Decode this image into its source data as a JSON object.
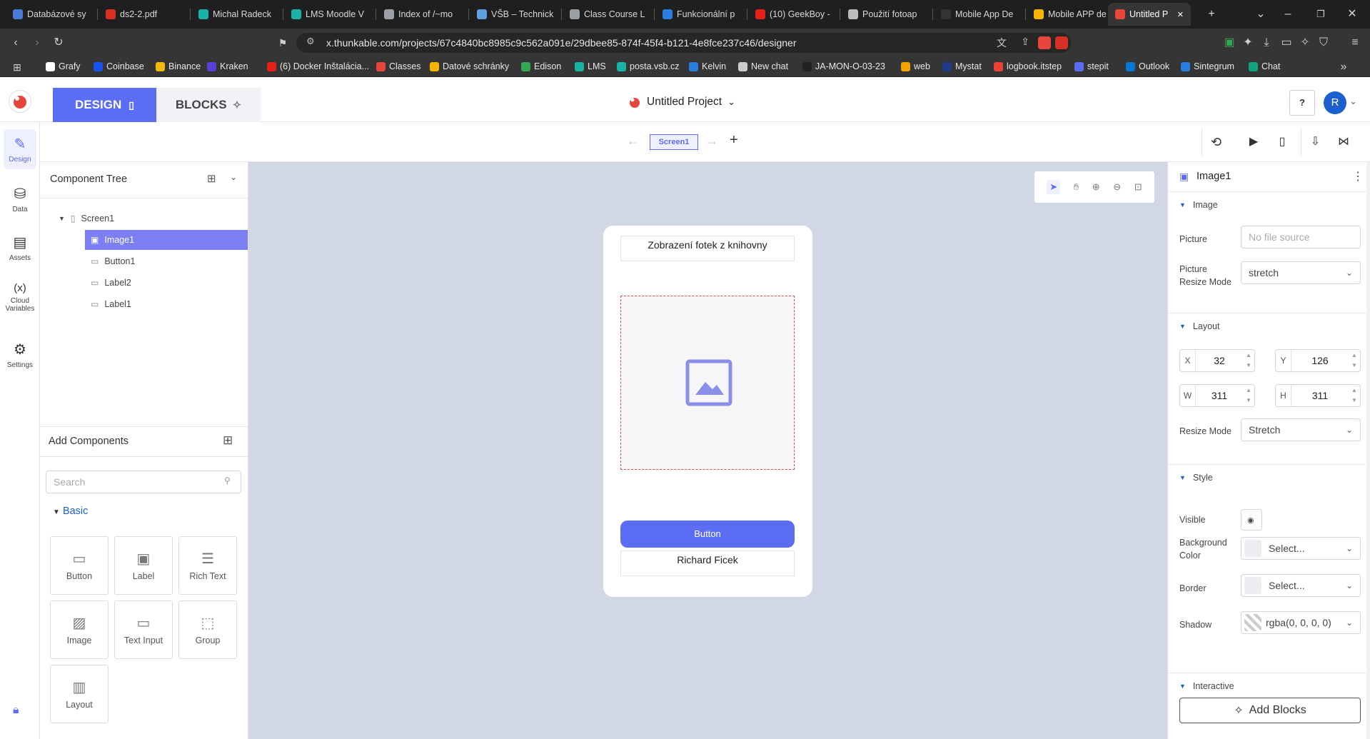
{
  "browser": {
    "tabs": [
      {
        "label": "Databázové sy",
        "color": "#4a7bd8"
      },
      {
        "label": "ds2-2.pdf",
        "color": "#d93025"
      },
      {
        "label": "Michal Radeck",
        "color": "#19b3a6"
      },
      {
        "label": "LMS Moodle V",
        "color": "#19b3a6"
      },
      {
        "label": "Index of /~mo",
        "color": "#9aa0a6"
      },
      {
        "label": "VŠB – Technick",
        "color": "#5fa0e0"
      },
      {
        "label": "Class Course L",
        "color": "#9aa0a6"
      },
      {
        "label": "Funkcionální p",
        "color": "#2a7de1"
      },
      {
        "label": "(10) GeekBoy -",
        "color": "#e62117"
      },
      {
        "label": "Použití fotoap",
        "color": "#bbbbbb"
      },
      {
        "label": "Mobile App De",
        "color": "#333333"
      },
      {
        "label": "Mobile APP de",
        "color": "#f4b400"
      },
      {
        "label": "Untitled P",
        "color": "#e8453c"
      }
    ],
    "url": "x.thunkable.com/projects/67c4840bc8985c9c562a091e/29dbee85-874f-45f4-b121-4e8fce237c46/designer",
    "bookmarks": [
      {
        "label": "Grafy",
        "color": "#ffffff"
      },
      {
        "label": "Coinbase",
        "color": "#1652f0"
      },
      {
        "label": "Binance",
        "color": "#f0b90b"
      },
      {
        "label": "Kraken",
        "color": "#5741d9"
      },
      {
        "label": "(6) Docker Inštalácia...",
        "color": "#e62117"
      },
      {
        "label": "Classes",
        "color": "#e8453c"
      },
      {
        "label": "Datové schránky",
        "color": "#f4b400"
      },
      {
        "label": "Edison",
        "color": "#34a853"
      },
      {
        "label": "LMS",
        "color": "#19b3a6"
      },
      {
        "label": "posta.vsb.cz",
        "color": "#19b3a6"
      },
      {
        "label": "Kelvin",
        "color": "#2a7de1"
      },
      {
        "label": "New chat",
        "color": "#cccccc"
      },
      {
        "label": "JA-MON-O-03-23",
        "color": "#222222"
      },
      {
        "label": "web",
        "color": "#f4a400"
      },
      {
        "label": "Mystat",
        "color": "#1e3a8a"
      },
      {
        "label": "logbook.itstep",
        "color": "#ea4335"
      },
      {
        "label": "stepit",
        "color": "#5b6cf5"
      },
      {
        "label": "Outlook",
        "color": "#0078d4"
      },
      {
        "label": "Sintegrum",
        "color": "#2a7de1"
      },
      {
        "label": "Chat",
        "color": "#10a37f"
      }
    ]
  },
  "header": {
    "design_label": "DESIGN",
    "blocks_label": "BLOCKS",
    "project_title": "Untitled Project",
    "avatar_initial": "R"
  },
  "rail": [
    {
      "label": "Design",
      "icon": "pencil-icon"
    },
    {
      "label": "Data",
      "icon": "database-icon"
    },
    {
      "label": "Assets",
      "icon": "file-icon"
    },
    {
      "label": "Cloud Variables",
      "icon": "variable-icon"
    },
    {
      "label": "Settings",
      "icon": "gear-icon"
    }
  ],
  "screens": {
    "current": "Screen1"
  },
  "tree": {
    "title": "Component Tree",
    "items": [
      {
        "label": "Screen1",
        "level": 0
      },
      {
        "label": "Image1",
        "level": 1,
        "selected": true
      },
      {
        "label": "Button1",
        "level": 1
      },
      {
        "label": "Label2",
        "level": 1
      },
      {
        "label": "Label1",
        "level": 1
      }
    ]
  },
  "add_components": {
    "title": "Add Components",
    "search_placeholder": "Search",
    "category": "Basic",
    "items": [
      "Button",
      "Label",
      "Rich Text",
      "Image",
      "Text Input",
      "Group",
      "Layout"
    ]
  },
  "phone": {
    "label_top": "Zobrazení fotek z knihovny",
    "button": "Button",
    "label_bottom": "Richard Ficek"
  },
  "props": {
    "component": "Image1",
    "sections": {
      "image": "Image",
      "layout": "Layout",
      "style": "Style",
      "interactive": "Interactive"
    },
    "picture_label": "Picture",
    "picture_placeholder": "No file source",
    "resize_mode_label": "Picture Resize Mode",
    "picture_resize_mode": "stretch",
    "x": "32",
    "y": "126",
    "w": "311",
    "h": "311",
    "resize_label": "Resize Mode",
    "resize_mode": "Stretch",
    "visible_label": "Visible",
    "bg_label": "Background Color",
    "bg_value": "Select...",
    "border_label": "Border",
    "border_value": "Select...",
    "shadow_label": "Shadow",
    "shadow_value": "rgba(0, 0, 0, 0)",
    "add_blocks": "Add Blocks"
  },
  "colors": {
    "accent": "#5b6cf5",
    "canvas": "#d2d7e6",
    "selection": "#7b7ff2"
  }
}
